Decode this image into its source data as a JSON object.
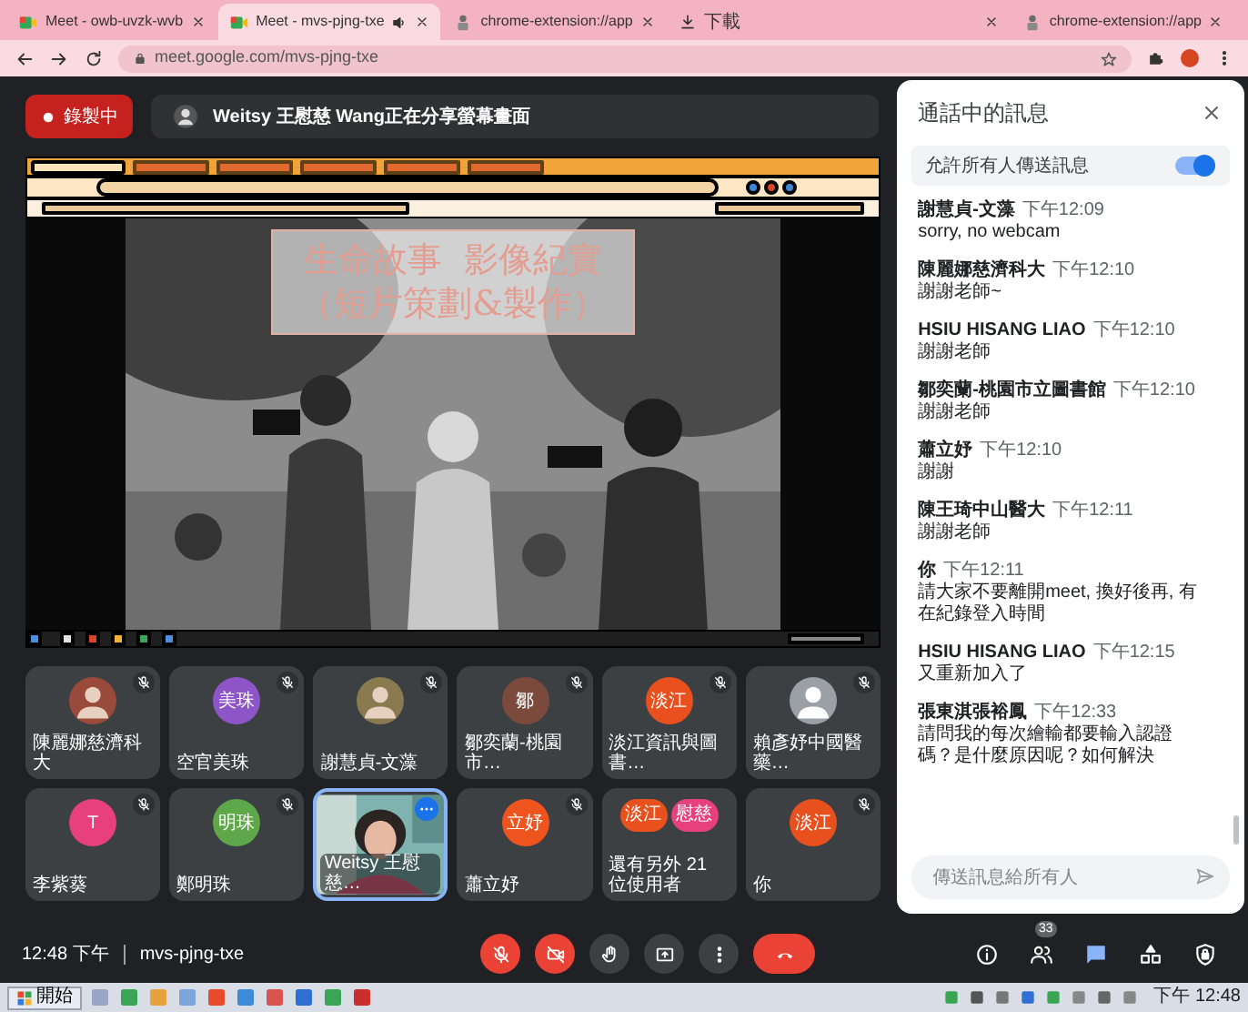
{
  "browser": {
    "tabs": [
      {
        "title": "Meet - owb-uvzk-wvb",
        "kind": "meet",
        "audio": false,
        "selected": false
      },
      {
        "title": "Meet - mvs-pjng-txe",
        "kind": "meet",
        "audio": true,
        "selected": true
      },
      {
        "title": "chrome-extension://app",
        "kind": "extension",
        "audio": false,
        "selected": false
      },
      {
        "title": "下載",
        "kind": "download",
        "audio": false,
        "selected": false
      },
      {
        "title": "chrome-extension://app",
        "kind": "extension",
        "audio": false,
        "selected": false
      }
    ],
    "url": "meet.google.com/mvs-pjng-txe"
  },
  "recording": {
    "label": "錄製中"
  },
  "presenter": {
    "text": "Weitsy 王慰慈 Wang正在分享螢幕畫面"
  },
  "shared_screen": {
    "slide_title": [
      "生命故事  影像紀實",
      "（短片策劃&製作）"
    ]
  },
  "tiles": [
    {
      "name": "陳麗娜慈濟科大",
      "muted": true,
      "selected": false
    },
    {
      "name": "空官美珠",
      "avatar": {
        "kind": "initials",
        "text": "美珠",
        "color": "#8e55c9"
      },
      "muted": true,
      "selected": false
    },
    {
      "name": "謝慧貞-文藻",
      "muted": true,
      "selected": false
    },
    {
      "name": "鄒奕蘭-桃園市…",
      "avatar": {
        "kind": "initials",
        "text": "鄒",
        "color": "#7b4a3c"
      },
      "muted": true,
      "selected": false
    },
    {
      "name": "淡江資訊與圖書…",
      "avatar": {
        "kind": "initials",
        "text": "淡江",
        "color": "#e8501e"
      },
      "muted": true,
      "selected": false
    },
    {
      "name": "賴彥妤中國醫藥…",
      "avatar": {
        "kind": "silhouette",
        "color": "#9aa0a6"
      },
      "muted": true,
      "selected": false
    },
    {
      "name": "李紫葵",
      "avatar": {
        "kind": "initials",
        "text": "T",
        "color": "#e8407a"
      },
      "muted": true,
      "selected": false
    },
    {
      "name": "鄭明珠",
      "avatar": {
        "kind": "initials",
        "text": "明珠",
        "color": "#5fa84a"
      },
      "muted": true,
      "selected": false
    },
    {
      "name": "Weitsy 王慰慈…",
      "avatar": {
        "kind": "video"
      },
      "muted": false,
      "selected": true
    },
    {
      "name": "蕭立妤",
      "avatar": {
        "kind": "initials",
        "text": "立妤",
        "color": "#f0541e"
      },
      "muted": true,
      "selected": false
    },
    {
      "name": "還有另外 21 位使用者",
      "avatar": {
        "kind": "group",
        "members": [
          {
            "text": "淡江",
            "color": "#e8501e"
          },
          {
            "text": "慰慈",
            "color": "#e8407a"
          }
        ]
      },
      "muted": false,
      "selected": false
    },
    {
      "name": "你",
      "avatar": {
        "kind": "initials",
        "text": "淡江",
        "color": "#e8501e"
      },
      "muted": true,
      "selected": false
    }
  ],
  "bottom_bar": {
    "time": "12:48 下午",
    "meeting_code": "mvs-pjng-txe",
    "controls": [
      {
        "kind": "mic",
        "on": false
      },
      {
        "kind": "camera",
        "on": false
      },
      {
        "kind": "hand"
      },
      {
        "kind": "present"
      },
      {
        "kind": "more"
      },
      {
        "kind": "end_call"
      }
    ],
    "side_buttons": [
      {
        "kind": "info",
        "selected": false
      },
      {
        "kind": "people",
        "selected": false,
        "badge": "33"
      },
      {
        "kind": "chat",
        "selected": true
      },
      {
        "kind": "activities",
        "selected": false
      },
      {
        "kind": "host_controls",
        "selected": false
      }
    ]
  },
  "chat": {
    "title": "通話中的訊息",
    "allow_all": {
      "label": "允許所有人傳送訊息",
      "on": true
    },
    "messages": [
      {
        "sender": "謝慧貞-文藻",
        "time": "下午12:09",
        "text": "sorry, no webcam"
      },
      {
        "sender": "陳麗娜慈濟科大",
        "time": "下午12:10",
        "text": "謝謝老師~"
      },
      {
        "sender": "HSIU HISANG LIAO",
        "time": "下午12:10",
        "text": "謝謝老師"
      },
      {
        "sender": "鄒奕蘭-桃園市立圖書館",
        "time": "下午12:10",
        "text": "謝謝老師"
      },
      {
        "sender": "蕭立妤",
        "time": "下午12:10",
        "text": "謝謝"
      },
      {
        "sender": "陳王琦中山醫大",
        "time": "下午12:11",
        "text": "謝謝老師"
      },
      {
        "sender": "你",
        "time": "下午12:11",
        "text": "請大家不要離開meet, 換好後再, 有在紀錄登入時間"
      },
      {
        "sender": "HSIU HISANG LIAO",
        "time": "下午12:15",
        "text": "又重新加入了"
      },
      {
        "sender": "張東淇張裕鳳",
        "time": "下午12:33",
        "text": "請問我的每次繪輸都要輸入認證碼？是什麼原因呢？如何解決"
      }
    ],
    "input_placeholder": "傳送訊息給所有人"
  },
  "taskbar": {
    "start_label": "開始",
    "clock": "下午 12:48"
  }
}
